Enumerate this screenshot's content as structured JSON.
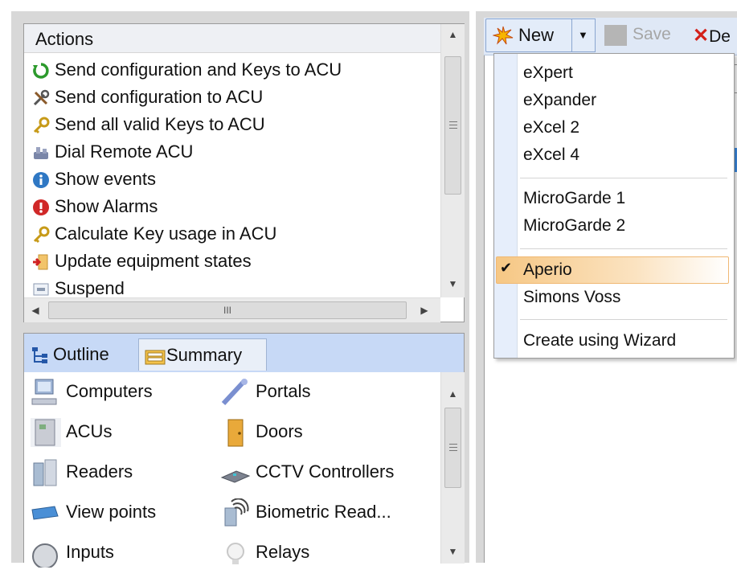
{
  "actions": {
    "header": "Actions",
    "items": [
      {
        "label": "Send configuration and Keys to ACU",
        "icon": "refresh-arrows-icon"
      },
      {
        "label": "Send configuration to ACU",
        "icon": "tools-icon"
      },
      {
        "label": "Send all valid Keys to ACU",
        "icon": "key-icon"
      },
      {
        "label": "Dial Remote ACU",
        "icon": "phone-icon"
      },
      {
        "label": "Show events",
        "icon": "info-icon"
      },
      {
        "label": "Show Alarms",
        "icon": "alarm-icon"
      },
      {
        "label": "Calculate Key usage in ACU",
        "icon": "key-icon"
      },
      {
        "label": "Update equipment states",
        "icon": "update-icon"
      },
      {
        "label": "Suspend",
        "icon": "suspend-icon"
      }
    ],
    "hscroll_grip": "III"
  },
  "navigator": {
    "tabs": [
      {
        "label": "Outline",
        "icon": "outline-tree-icon",
        "active": false
      },
      {
        "label": "Summary",
        "icon": "summary-folder-icon",
        "active": true
      }
    ],
    "items_left": [
      {
        "label": "Computers",
        "icon": "computer-icon"
      },
      {
        "label": "ACUs",
        "icon": "acu-icon"
      },
      {
        "label": "Readers",
        "icon": "reader-icon"
      },
      {
        "label": "View points",
        "icon": "viewpoint-icon"
      },
      {
        "label": "Inputs",
        "icon": "input-icon"
      }
    ],
    "items_right": [
      {
        "label": "Portals",
        "icon": "portal-icon"
      },
      {
        "label": "Doors",
        "icon": "door-icon"
      },
      {
        "label": "CCTV Controllers",
        "icon": "cctv-icon"
      },
      {
        "label": "Biometric Read...",
        "icon": "fingerprint-icon"
      },
      {
        "label": "Relays",
        "icon": "relay-bulb-icon"
      }
    ]
  },
  "toolbar": {
    "new_label": "New",
    "save_label": "Save",
    "delete_label": "De"
  },
  "new_menu": {
    "groups": [
      [
        "eXpert",
        "eXpander",
        "eXcel 2",
        "eXcel 4"
      ],
      [
        "MicroGarde 1",
        "MicroGarde 2"
      ],
      [
        "Aperio",
        "Simons Voss"
      ],
      [
        "Create using Wizard"
      ]
    ],
    "checked_item": "Aperio",
    "highlighted_item": "Aperio"
  },
  "colors": {
    "tab_bar": "#c7d9f6",
    "menu_highlight": "#f6c784",
    "selection_blue": "#3d8ee6"
  }
}
